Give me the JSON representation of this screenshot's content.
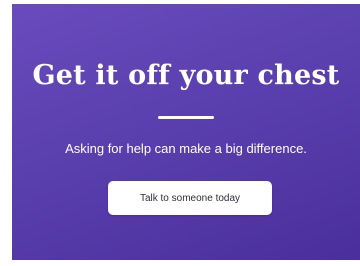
{
  "banner": {
    "headline": "Get it off your chest",
    "subtext": "Asking for help can make a big difference.",
    "cta_label": "Talk to someone today"
  },
  "colors": {
    "background_gradient_start": "#6a4bbd",
    "background_gradient_end": "#4a2f9c",
    "text": "#ffffff",
    "button_background": "#ffffff",
    "button_text": "#2e2e3a"
  }
}
